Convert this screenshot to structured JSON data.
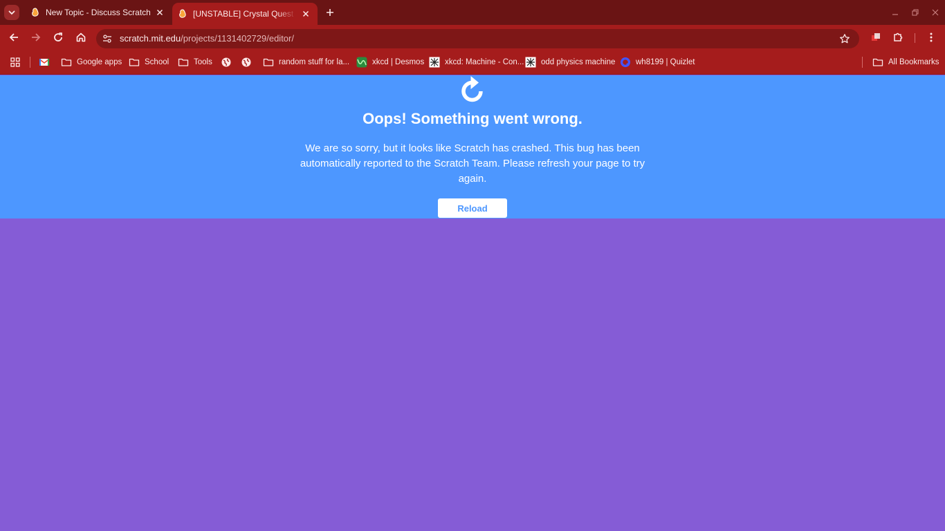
{
  "browser": {
    "tabs": [
      {
        "title": "New Topic - Discuss Scratch",
        "active": false,
        "icon": "scratch-icon"
      },
      {
        "title": "[UNSTABLE] Crystal Quest II: Rises",
        "active": true,
        "icon": "scratch-icon"
      }
    ],
    "omnibox": {
      "domain": "scratch.mit.edu",
      "path": "/projects/1131402729/editor/"
    },
    "bookmarks": [
      {
        "label": "",
        "icon": "gmail-icon"
      },
      {
        "label": "Google apps",
        "icon": "folder-icon"
      },
      {
        "label": "School",
        "icon": "folder-icon"
      },
      {
        "label": "Tools",
        "icon": "folder-icon"
      },
      {
        "label": "",
        "icon": "globe-icon"
      },
      {
        "label": "",
        "icon": "globe-icon"
      },
      {
        "label": "random stuff for la...",
        "icon": "folder-icon"
      },
      {
        "label": "xkcd | Desmos",
        "icon": "desmos-icon"
      },
      {
        "label": "xkcd: Machine - Con...",
        "icon": "xkcd-icon"
      },
      {
        "label": "odd physics machine",
        "icon": "xkcd-icon"
      },
      {
        "label": "wh8199 | Quizlet",
        "icon": "quizlet-icon"
      }
    ],
    "all_bookmarks": "All Bookmarks",
    "colors": {
      "frame": "#6a1414",
      "toolbar": "#a51c1c",
      "omnibox": "#7e1717"
    }
  },
  "page": {
    "title": "Oops! Something went wrong.",
    "message": "We are so sorry, but it looks like Scratch has crashed. This bug has been automatically reported to the Scratch Team. Please refresh your page to try again.",
    "reload_label": "Reload",
    "colors": {
      "banner": "#4d97ff",
      "background": "#855cd6",
      "button_text": "#4d97ff"
    }
  }
}
